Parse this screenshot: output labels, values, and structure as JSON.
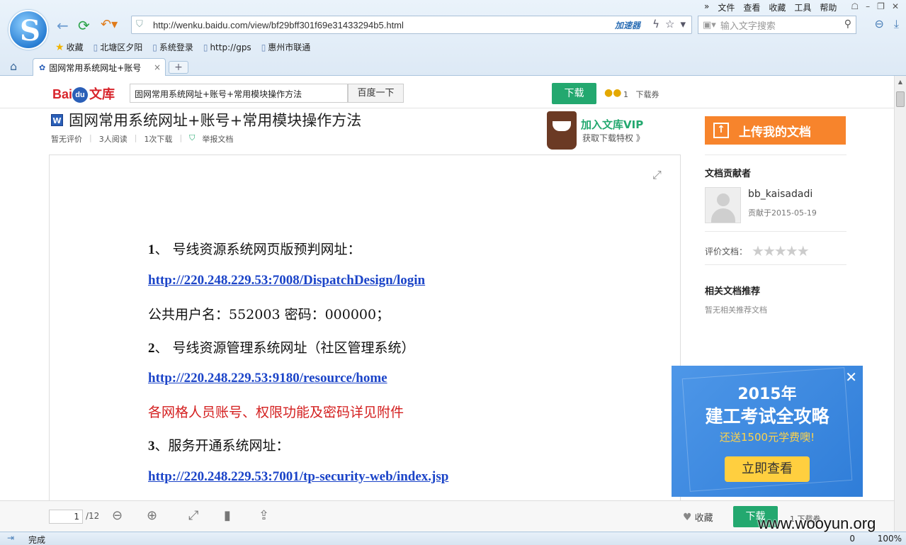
{
  "browser": {
    "menu": [
      "文件",
      "查看",
      "收藏",
      "工具",
      "帮助"
    ],
    "url": "http://wenku.baidu.com/view/bf29bff301f69e31433294b5.html",
    "accelerator_label": "加速器",
    "search_placeholder": "输入文字搜索",
    "favorites": [
      "收藏",
      "北塘区夕阳",
      "系统登录",
      "http://gps",
      "惠州市联通"
    ],
    "tab_title": "固网常用系统网址+账号",
    "status_text": "完成",
    "status_count": "0",
    "zoom": "100%"
  },
  "header": {
    "logo_bai": "Bai",
    "logo_du": "du",
    "logo_wenku": "文库",
    "search_value": "固网常用系统网址+账号+常用模块操作方法",
    "search_button": "百度一下",
    "download_button": "下载",
    "coin_count": "1",
    "coin_label": "下载券"
  },
  "doc": {
    "type_icon": "W",
    "title": "固网常用系统网址+账号+常用模块操作方法",
    "meta": [
      "暂无评价",
      "3人阅读",
      "1次下载",
      "举报文档"
    ],
    "vip_title": "加入文库VIP",
    "vip_sub": "获取下载特权 》"
  },
  "content": {
    "l1_num": "1",
    "l1_text": "、    号线资源系统网页版预判网址：",
    "l2_link": "http://220.248.229.53:7008/DispatchDesign/login",
    "l3_text": "公共用户名：552003        密码：000000；",
    "l4_num": "2",
    "l4_text": "、    号线资源管理系统网址（社区管理系统）",
    "l5_link": "http://220.248.229.53:9180/resource/home",
    "l6_text": "各网格人员账号、权限功能及密码详见附件",
    "l7_num": "3",
    "l7_text": "、服务开通系统网址：",
    "l8_link": "http://220.248.229.53:7001/tp-security-web/index.jsp"
  },
  "sidebar": {
    "upload_label": "上传我的文档",
    "contributor_heading": "文档贡献者",
    "username": "bb_kaisadadi",
    "contrib_date": "贡献于2015-05-19",
    "rating_label": "评价文档：",
    "related_heading": "相关文档推荐",
    "related_empty": "暂无相关推荐文档"
  },
  "ad": {
    "year": "2015年",
    "title": "建工考试全攻略",
    "sub": "还送1500元学费噢!",
    "cta": "立即查看"
  },
  "bottom": {
    "page_current": "1",
    "page_total": "/12",
    "collect_label": "收藏",
    "download_button": "下载",
    "coin_text": "1 下载券"
  },
  "watermark": "www.wooyun.org"
}
